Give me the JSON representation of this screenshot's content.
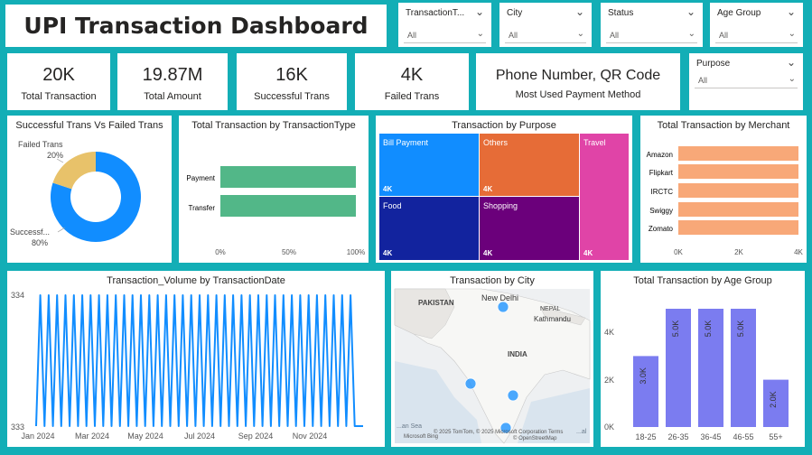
{
  "header": {
    "title": "UPI Transaction Dashboard"
  },
  "slicers": [
    {
      "label": "TransactionT...",
      "value": "All"
    },
    {
      "label": "City",
      "value": "All"
    },
    {
      "label": "Status",
      "value": "All"
    },
    {
      "label": "Age Group",
      "value": "All"
    }
  ],
  "purpose_slicer": {
    "label": "Purpose",
    "value": "All"
  },
  "chevron": "⌄",
  "dropdown_caret": "⌄",
  "kpis": [
    {
      "value": "20K",
      "label": "Total Transaction"
    },
    {
      "value": "19.87M",
      "label": "Total Amount"
    },
    {
      "value": "16K",
      "label": "Successful Trans"
    },
    {
      "value": "4K",
      "label": "Failed Trans"
    },
    {
      "value": "Phone Number, QR Code",
      "label": "Most Used Payment Method"
    }
  ],
  "visuals": {
    "donut_title": "Successful Trans Vs Failed Trans",
    "bar_type_title": "Total Transaction by TransactionType",
    "treemap_title": "Transaction by Purpose",
    "merchant_title": "Total Transaction by Merchant",
    "line_title": "Transaction_Volume by TransactionDate",
    "map_title": "Transaction by City",
    "age_title": "Total Transaction by Age Group"
  },
  "colors": {
    "accent": "#13aeb6",
    "blue": "#118dff",
    "gold": "#e8c26a",
    "green": "#52b788",
    "salmon": "#f8a878",
    "purple": "#7b7cf0"
  },
  "map": {
    "labels": {
      "pakistan": "PAKISTAN",
      "new_delhi": "New Delhi",
      "nepal": "NEPAL",
      "kathmandu": "Kathmandu",
      "india": "INDIA",
      "sea": "...an Sea",
      "bengal": "...al"
    },
    "copyright": "© 2025 TomTom, © 2025 Microsoft Corporation  Terms",
    "osm": "© OpenStreetMap",
    "bing": "Microsoft Bing"
  },
  "chart_data": [
    {
      "type": "pie",
      "title": "Successful Trans Vs Failed Trans",
      "categories": [
        "Successf...",
        "Failed Trans"
      ],
      "values": [
        80,
        20
      ],
      "labels": [
        "80%",
        "20%"
      ],
      "colors": [
        "#118dff",
        "#e8c26a"
      ]
    },
    {
      "type": "bar",
      "title": "Total Transaction by TransactionType",
      "orientation": "horizontal",
      "categories": [
        "Payment",
        "Transfer"
      ],
      "values": [
        100,
        100
      ],
      "x_ticks": [
        "0%",
        "50%",
        "100%"
      ],
      "xlim": [
        0,
        100
      ]
    },
    {
      "type": "treemap",
      "title": "Transaction by Purpose",
      "categories": [
        "Bill Payment",
        "Others",
        "Travel",
        "Food",
        "Shopping"
      ],
      "value_labels": [
        "4K",
        "4K",
        "4K",
        "4K",
        "4K"
      ],
      "colors": [
        "#118dff",
        "#e66c37",
        "#e044a7",
        "#12239e",
        "#6b007b"
      ]
    },
    {
      "type": "bar",
      "title": "Total Transaction by Merchant",
      "orientation": "horizontal",
      "categories": [
        "Amazon",
        "Flipkart",
        "IRCTC",
        "Swiggy",
        "Zomato"
      ],
      "values": [
        4000,
        4000,
        4000,
        4000,
        4000
      ],
      "x_ticks": [
        "0K",
        "2K",
        "4K"
      ],
      "xlim": [
        0,
        4000
      ]
    },
    {
      "type": "line",
      "title": "Transaction_Volume by TransactionDate",
      "x_ticks": [
        "Jan 2024",
        "Mar 2024",
        "May 2024",
        "Jul 2024",
        "Sep 2024",
        "Nov 2024"
      ],
      "y_ticks": [
        "334",
        "333"
      ],
      "ylim": [
        333,
        334
      ],
      "values": [
        333,
        334,
        333,
        334,
        333,
        334,
        333,
        334,
        333,
        334,
        333,
        334,
        333,
        334,
        333,
        334,
        333,
        334,
        333,
        334,
        333,
        334,
        333,
        334,
        333,
        334,
        333,
        334,
        333,
        334,
        333,
        334,
        333,
        334,
        333,
        334,
        333,
        334,
        333,
        334,
        333,
        334,
        333,
        334,
        333,
        334,
        333,
        334,
        333,
        334,
        333,
        334,
        333,
        334,
        333,
        334,
        333,
        334,
        333,
        334,
        333,
        334,
        333,
        334,
        333,
        334,
        333,
        334,
        333,
        334,
        333,
        334,
        333,
        334,
        333,
        334,
        333,
        333,
        333
      ]
    },
    {
      "type": "scatter",
      "title": "Transaction by City",
      "points": [
        {
          "name": "Delhi"
        },
        {
          "name": "Mumbai"
        },
        {
          "name": "Bengaluru"
        },
        {
          "name": "Chennai"
        }
      ]
    },
    {
      "type": "bar",
      "title": "Total Transaction by Age Group",
      "categories": [
        "18-25",
        "26-35",
        "36-45",
        "46-55",
        "55+"
      ],
      "values": [
        3000,
        5000,
        5000,
        5000,
        2000
      ],
      "value_labels": [
        "3.0K",
        "5.0K",
        "5.0K",
        "5.0K",
        "2.0K"
      ],
      "y_ticks": [
        "4K",
        "2K",
        "0K"
      ],
      "ylim": [
        0,
        5000
      ]
    }
  ]
}
